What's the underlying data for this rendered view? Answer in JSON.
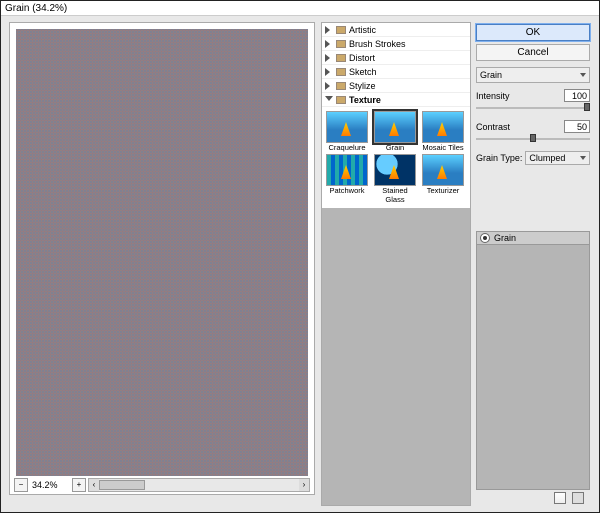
{
  "window": {
    "title": "Grain (34.2%)"
  },
  "preview": {
    "zoom": "34.2%"
  },
  "categories": {
    "items": [
      {
        "label": "Artistic",
        "expanded": false
      },
      {
        "label": "Brush Strokes",
        "expanded": false
      },
      {
        "label": "Distort",
        "expanded": false
      },
      {
        "label": "Sketch",
        "expanded": false
      },
      {
        "label": "Stylize",
        "expanded": false
      },
      {
        "label": "Texture",
        "expanded": true
      }
    ]
  },
  "thumbs": [
    {
      "label": "Craquelure"
    },
    {
      "label": "Grain"
    },
    {
      "label": "Mosaic Tiles"
    },
    {
      "label": "Patchwork"
    },
    {
      "label": "Stained Glass"
    },
    {
      "label": "Texturizer"
    }
  ],
  "buttons": {
    "ok": "OK",
    "cancel": "Cancel"
  },
  "filter": {
    "name": "Grain"
  },
  "params": {
    "intensity": {
      "label": "Intensity",
      "value": "100",
      "pos": 100
    },
    "contrast": {
      "label": "Contrast",
      "value": "50",
      "pos": 50
    }
  },
  "grain_type": {
    "label": "Grain Type:",
    "value": "Clumped"
  },
  "effects": {
    "item": "Grain"
  }
}
